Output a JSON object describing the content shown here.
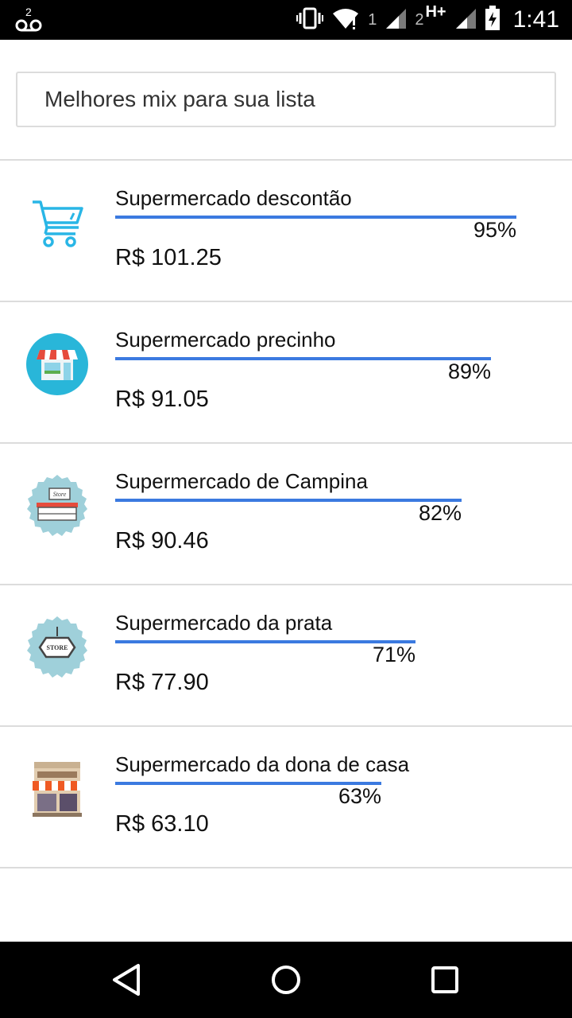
{
  "status_bar": {
    "voicemail_count": "2",
    "sim1_label": "1",
    "sim2_label": "2",
    "network_type": "H+",
    "time": "1:41",
    "icons": [
      "voicemail-icon",
      "vibrate-icon",
      "wifi-icon",
      "signal-icon",
      "battery-icon"
    ]
  },
  "header": {
    "search_text": "Melhores mix para sua lista"
  },
  "stores": [
    {
      "name": "Supermercado descontão",
      "percent": "95%",
      "percent_value": 95,
      "price": "R$ 101.25",
      "icon": "cart-icon"
    },
    {
      "name": "Supermercado precinho",
      "percent": "89%",
      "percent_value": 89,
      "price": "R$ 91.05",
      "icon": "store-front-icon"
    },
    {
      "name": "Supermercado de Campina",
      "percent": "82%",
      "percent_value": 82,
      "price": "R$ 90.46",
      "icon": "store-sign-icon"
    },
    {
      "name": "Supermercado da prata",
      "percent": "71%",
      "percent_value": 71,
      "price": "R$ 77.90",
      "icon": "store-badge-icon"
    },
    {
      "name": "Supermercado da dona de casa",
      "percent": "63%",
      "percent_value": 63,
      "price": "R$ 63.10",
      "icon": "shop-building-icon"
    }
  ],
  "nav_bar": {
    "icons": [
      "back-icon",
      "home-icon",
      "recents-icon"
    ]
  },
  "colors": {
    "bar": "#3b7ae0",
    "cart": "#29b6e6",
    "badge": "#9fd0da"
  }
}
